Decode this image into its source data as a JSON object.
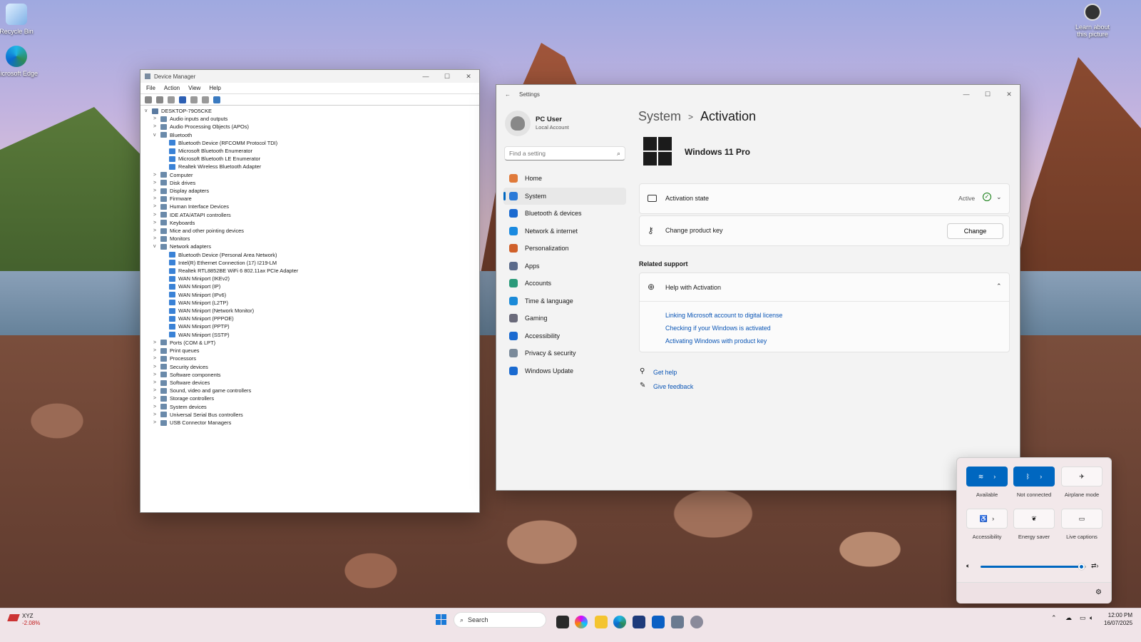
{
  "desktop": {
    "icons": [
      {
        "label": "Recycle Bin"
      },
      {
        "label": "Microsoft Edge"
      }
    ],
    "learn": "Learn about this picture"
  },
  "device_manager": {
    "title": "Device Manager",
    "menu": [
      "File",
      "Action",
      "View",
      "Help"
    ],
    "root": "DESKTOP-79O5CKE",
    "tree": [
      {
        "label": "Audio inputs and outputs",
        "level": 1,
        "exp": ">"
      },
      {
        "label": "Audio Processing Objects (APOs)",
        "level": 1,
        "exp": ">"
      },
      {
        "label": "Bluetooth",
        "level": 1,
        "exp": "v"
      },
      {
        "label": "Bluetooth Device (RFCOMM Protocol TDI)",
        "level": 2,
        "exp": ""
      },
      {
        "label": "Microsoft Bluetooth Enumerator",
        "level": 2,
        "exp": ""
      },
      {
        "label": "Microsoft Bluetooth LE Enumerator",
        "level": 2,
        "exp": ""
      },
      {
        "label": "Realtek Wireless Bluetooth Adapter",
        "level": 2,
        "exp": ""
      },
      {
        "label": "Computer",
        "level": 1,
        "exp": ">"
      },
      {
        "label": "Disk drives",
        "level": 1,
        "exp": ">"
      },
      {
        "label": "Display adapters",
        "level": 1,
        "exp": ">"
      },
      {
        "label": "Firmware",
        "level": 1,
        "exp": ">"
      },
      {
        "label": "Human Interface Devices",
        "level": 1,
        "exp": ">"
      },
      {
        "label": "IDE ATA/ATAPI controllers",
        "level": 1,
        "exp": ">"
      },
      {
        "label": "Keyboards",
        "level": 1,
        "exp": ">"
      },
      {
        "label": "Mice and other pointing devices",
        "level": 1,
        "exp": ">"
      },
      {
        "label": "Monitors",
        "level": 1,
        "exp": ">"
      },
      {
        "label": "Network adapters",
        "level": 1,
        "exp": "v"
      },
      {
        "label": "Bluetooth Device (Personal Area Network)",
        "level": 2,
        "exp": ""
      },
      {
        "label": "Intel(R) Ethernet Connection (17) I219-LM",
        "level": 2,
        "exp": ""
      },
      {
        "label": "Realtek RTL8852BE WiFi 6 802.11ax PCIe Adapter",
        "level": 2,
        "exp": ""
      },
      {
        "label": "WAN Miniport (IKEv2)",
        "level": 2,
        "exp": ""
      },
      {
        "label": "WAN Miniport (IP)",
        "level": 2,
        "exp": ""
      },
      {
        "label": "WAN Miniport (IPv6)",
        "level": 2,
        "exp": ""
      },
      {
        "label": "WAN Miniport (L2TP)",
        "level": 2,
        "exp": ""
      },
      {
        "label": "WAN Miniport (Network Monitor)",
        "level": 2,
        "exp": ""
      },
      {
        "label": "WAN Miniport (PPPOE)",
        "level": 2,
        "exp": ""
      },
      {
        "label": "WAN Miniport (PPTP)",
        "level": 2,
        "exp": ""
      },
      {
        "label": "WAN Miniport (SSTP)",
        "level": 2,
        "exp": ""
      },
      {
        "label": "Ports (COM & LPT)",
        "level": 1,
        "exp": ">"
      },
      {
        "label": "Print queues",
        "level": 1,
        "exp": ">"
      },
      {
        "label": "Processors",
        "level": 1,
        "exp": ">"
      },
      {
        "label": "Security devices",
        "level": 1,
        "exp": ">"
      },
      {
        "label": "Software components",
        "level": 1,
        "exp": ">"
      },
      {
        "label": "Software devices",
        "level": 1,
        "exp": ">"
      },
      {
        "label": "Sound, video and game controllers",
        "level": 1,
        "exp": ">"
      },
      {
        "label": "Storage controllers",
        "level": 1,
        "exp": ">"
      },
      {
        "label": "System devices",
        "level": 1,
        "exp": ">"
      },
      {
        "label": "Universal Serial Bus controllers",
        "level": 1,
        "exp": ">"
      },
      {
        "label": "USB Connector Managers",
        "level": 1,
        "exp": ">"
      }
    ]
  },
  "settings": {
    "title": "Settings",
    "user": {
      "name": "PC User",
      "account": "Local Account"
    },
    "search_placeholder": "Find a setting",
    "nav": [
      "Home",
      "System",
      "Bluetooth & devices",
      "Network & internet",
      "Personalization",
      "Apps",
      "Accounts",
      "Time & language",
      "Gaming",
      "Accessibility",
      "Privacy & security",
      "Windows Update"
    ],
    "nav_selected": 1,
    "breadcrumb": {
      "parent": "System",
      "sep": ">",
      "current": "Activation"
    },
    "edition": "Windows 11 Pro",
    "activation_state": {
      "label": "Activation state",
      "value": "Active"
    },
    "product_key": {
      "label": "Change product key",
      "button": "Change"
    },
    "related": "Related support",
    "help": {
      "title": "Help with Activation",
      "links": [
        "Linking Microsoft account to digital license",
        "Checking if your Windows is activated",
        "Activating Windows with product key"
      ]
    },
    "get_help": "Get help",
    "feedback": "Give feedback"
  },
  "quick_settings": {
    "tiles": [
      "Available",
      "Not connected",
      "Airplane mode",
      "Accessibility",
      "Energy saver",
      "Live captions"
    ],
    "volume": 0.96
  },
  "taskbar": {
    "stock": {
      "name": "XYZ",
      "change": "-2.08%"
    },
    "search": "Search",
    "time": "12:00 PM",
    "date": "16/07/2025"
  },
  "colors": {
    "accent": "#0067c0",
    "link": "#0a55b5"
  }
}
